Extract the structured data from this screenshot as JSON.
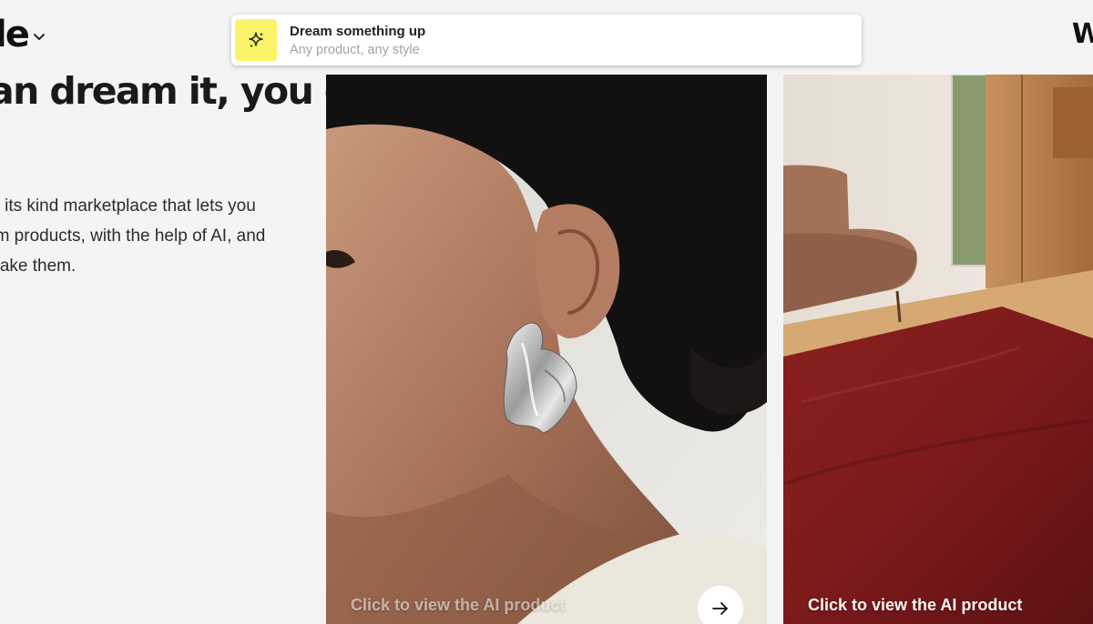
{
  "header": {
    "logo_text": "le",
    "right_glyph": "W"
  },
  "prompt": {
    "title": "Dream something up",
    "subtitle": "Any product, any style"
  },
  "hero": {
    "heading": "an dream it, you can",
    "body_lines": [
      "of its kind marketplace that lets you",
      "am products, with the help of AI, and",
      "make them."
    ]
  },
  "cards": [
    {
      "cta": "Click to view the AI product",
      "subject": "silver earring portrait"
    },
    {
      "cta": "Click to view the AI product",
      "subject": "red rug living room"
    }
  ],
  "colors": {
    "page_bg": "#f4f4f4",
    "accent_yellow": "#fbf36a",
    "card_cta": "#ffffff"
  }
}
